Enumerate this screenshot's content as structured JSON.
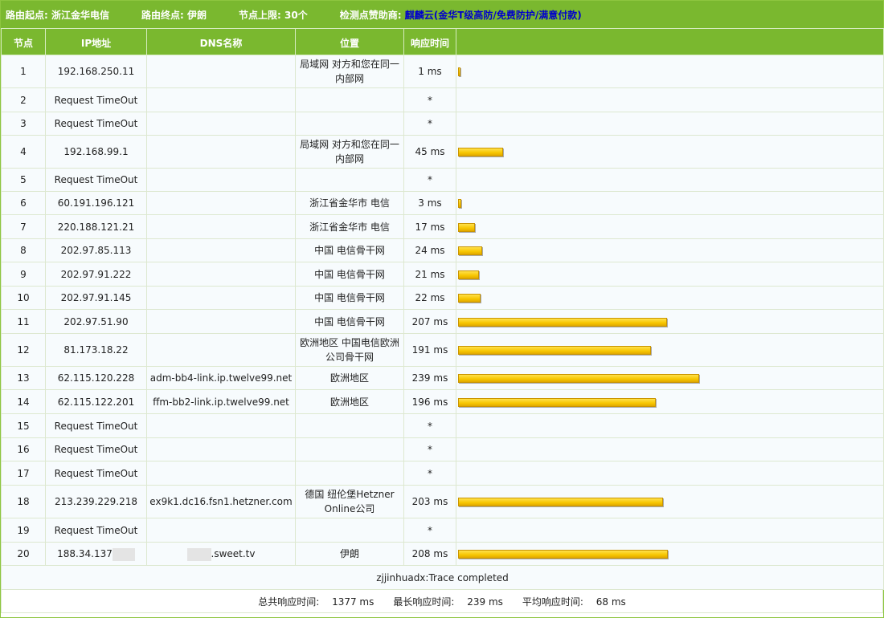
{
  "topbar": {
    "start_label": "路由起点:",
    "start_value": "浙江金华电信",
    "end_label": "路由终点:",
    "end_value": "伊朗",
    "limit_label": "节点上限:",
    "limit_value": "30个",
    "sponsor_label": "检测点赞助商:",
    "sponsor_name": "麒麟云",
    "sponsor_open": "(",
    "sponsor_link1": "金华T级高防",
    "sponsor_sep1": "/",
    "sponsor_link2": "免费防护",
    "sponsor_sep2": "/",
    "sponsor_link3": "满意付款",
    "sponsor_close": ")"
  },
  "columns": [
    "节点",
    "IP地址",
    "DNS名称",
    "位置",
    "响应时间",
    ""
  ],
  "rows": [
    {
      "hop": "1",
      "ip": "192.168.250.11",
      "dns": "",
      "loc": "局域网 对方和您在同一内部网",
      "time": "1 ms",
      "ms": 1
    },
    {
      "hop": "2",
      "ip": "Request TimeOut",
      "dns": "",
      "loc": "",
      "time": "*",
      "ms": 0
    },
    {
      "hop": "3",
      "ip": "Request TimeOut",
      "dns": "",
      "loc": "",
      "time": "*",
      "ms": 0
    },
    {
      "hop": "4",
      "ip": "192.168.99.1",
      "dns": "",
      "loc": "局域网 对方和您在同一内部网",
      "time": "45 ms",
      "ms": 45
    },
    {
      "hop": "5",
      "ip": "Request TimeOut",
      "dns": "",
      "loc": "",
      "time": "*",
      "ms": 0
    },
    {
      "hop": "6",
      "ip": "60.191.196.121",
      "dns": "",
      "loc": "浙江省金华市 电信",
      "time": "3 ms",
      "ms": 3
    },
    {
      "hop": "7",
      "ip": "220.188.121.21",
      "dns": "",
      "loc": "浙江省金华市 电信",
      "time": "17 ms",
      "ms": 17
    },
    {
      "hop": "8",
      "ip": "202.97.85.113",
      "dns": "",
      "loc": "中国 电信骨干网",
      "time": "24 ms",
      "ms": 24
    },
    {
      "hop": "9",
      "ip": "202.97.91.222",
      "dns": "",
      "loc": "中国 电信骨干网",
      "time": "21 ms",
      "ms": 21
    },
    {
      "hop": "10",
      "ip": "202.97.91.145",
      "dns": "",
      "loc": "中国 电信骨干网",
      "time": "22 ms",
      "ms": 22
    },
    {
      "hop": "11",
      "ip": "202.97.51.90",
      "dns": "",
      "loc": "中国 电信骨干网",
      "time": "207 ms",
      "ms": 207
    },
    {
      "hop": "12",
      "ip": "81.173.18.22",
      "dns": "",
      "loc": "欧洲地区 中国电信欧洲公司骨干网",
      "time": "191 ms",
      "ms": 191
    },
    {
      "hop": "13",
      "ip": "62.115.120.228",
      "dns": "adm-bb4-link.ip.twelve99.net",
      "loc": "欧洲地区",
      "time": "239 ms",
      "ms": 239
    },
    {
      "hop": "14",
      "ip": "62.115.122.201",
      "dns": "ffm-bb2-link.ip.twelve99.net",
      "loc": "欧洲地区",
      "time": "196 ms",
      "ms": 196
    },
    {
      "hop": "15",
      "ip": "Request TimeOut",
      "dns": "",
      "loc": "",
      "time": "*",
      "ms": 0
    },
    {
      "hop": "16",
      "ip": "Request TimeOut",
      "dns": "",
      "loc": "",
      "time": "*",
      "ms": 0
    },
    {
      "hop": "17",
      "ip": "Request TimeOut",
      "dns": "",
      "loc": "",
      "time": "*",
      "ms": 0
    },
    {
      "hop": "18",
      "ip": "213.239.229.218",
      "dns": "ex9k1.dc16.fsn1.hetzner.com",
      "loc": "德国 纽伦堡Hetzner Online公司",
      "time": "203 ms",
      "ms": 203
    },
    {
      "hop": "19",
      "ip": "Request TimeOut",
      "dns": "",
      "loc": "",
      "time": "*",
      "ms": 0
    },
    {
      "hop": "20",
      "ip": "188.34.137",
      "dns": ".sweet.tv",
      "loc": "伊朗",
      "time": "208 ms",
      "ms": 208,
      "masked": true
    }
  ],
  "trace_status": "zjjinhuadx:Trace completed",
  "summary": {
    "total_label": "总共响应时间:",
    "total_value": "1377 ms",
    "max_label": "最长响应时间:",
    "max_value": "239 ms",
    "avg_label": "平均响应时间:",
    "avg_value": "68 ms"
  }
}
